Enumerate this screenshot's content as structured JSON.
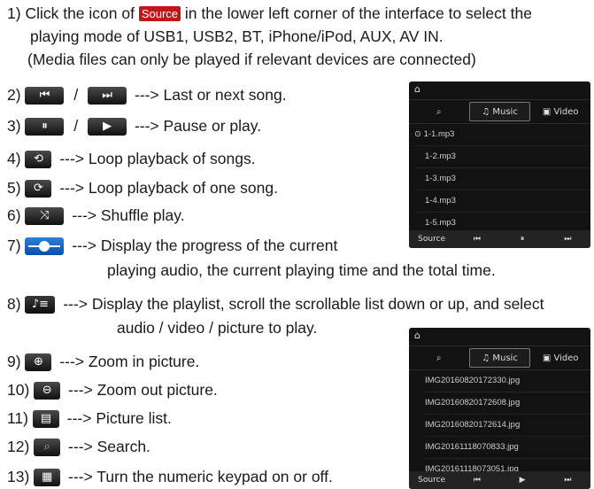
{
  "step1": {
    "num": "1)",
    "before": "Click the icon of",
    "badge": "Source",
    "after": "in the lower left corner of the interface to select the",
    "line2": "playing mode of USB1, USB2, BT, iPhone/iPod, AUX, AV IN.",
    "line3": "(Media files can only be played if relevant devices are connected)"
  },
  "items": [
    {
      "num": "2)",
      "text": "---> Last or next song.",
      "slash": "/"
    },
    {
      "num": "3)",
      "text": "---> Pause or play.",
      "slash": "/"
    },
    {
      "num": "4)",
      "text": "---> Loop playback of songs."
    },
    {
      "num": "5)",
      "text": "---> Loop playback of one song."
    },
    {
      "num": "6)",
      "text": "---> Shuffle play."
    },
    {
      "num": "7)",
      "text": "---> Display the progress of the current",
      "cont": "playing audio, the current playing time and the total time."
    },
    {
      "num": "8)",
      "text": "---> Display the playlist, scroll the scrollable list down or up, and select",
      "cont": "audio / video / picture to play."
    },
    {
      "num": "9)",
      "text": "---> Zoom in picture."
    },
    {
      "num": "10)",
      "text": "---> Zoom out picture."
    },
    {
      "num": "11)",
      "text": "---> Picture list."
    },
    {
      "num": "12)",
      "text": "---> Search."
    },
    {
      "num": "13)",
      "text": "---> Turn the numeric keypad on or off."
    }
  ],
  "screen_music": {
    "tabs": [
      "Music",
      "Video"
    ],
    "rows": [
      "1-1.mp3",
      "1-2.mp3",
      "1-3.mp3",
      "1-4.mp3",
      "1-5.mp3"
    ],
    "bar": [
      "Source",
      "⏮",
      "⏸",
      "⏭"
    ]
  },
  "screen_picture": {
    "tabs": [
      "Music",
      "Video"
    ],
    "rows": [
      "IMG20160820172330.jpg",
      "IMG20160820172608.jpg",
      "IMG20160820172614.jpg",
      "IMG20161118070833.jpg",
      "IMG20161118073051.jpg"
    ],
    "bar": [
      "Source",
      "⏮",
      "▶",
      "⏭"
    ]
  }
}
